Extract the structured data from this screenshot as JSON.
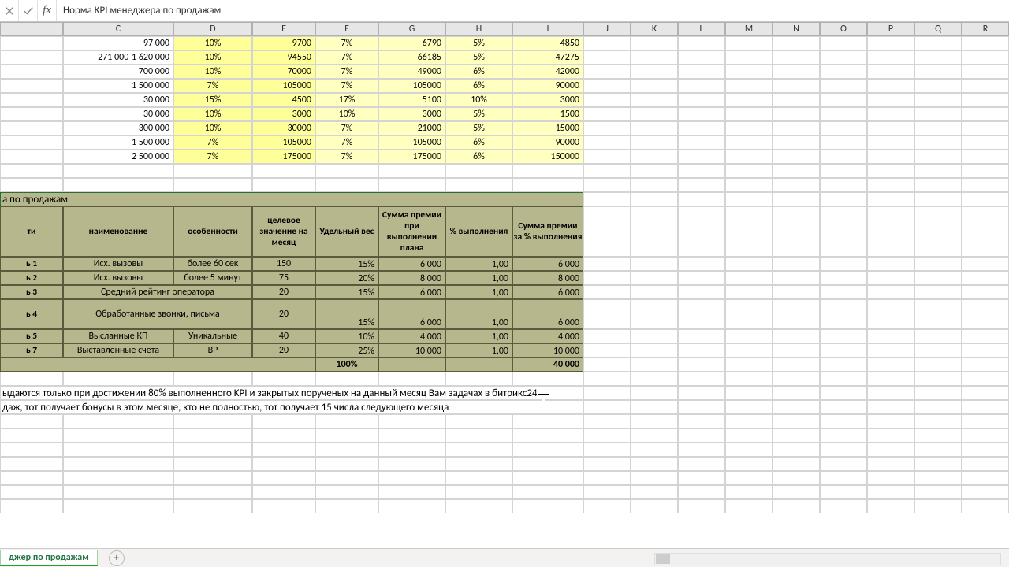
{
  "formula": "Норма KPI менеджера по продажам",
  "columns": [
    "",
    "C",
    "D",
    "E",
    "F",
    "G",
    "H",
    "I",
    "J",
    "K",
    "L",
    "M",
    "N",
    "O",
    "P",
    "Q",
    "R"
  ],
  "upperRows": [
    {
      "c": "97 000",
      "d": "10%",
      "e": "9700",
      "f": "7%",
      "g": "6790",
      "h": "5%",
      "i": "4850"
    },
    {
      "c": "271 000-1 620 000",
      "d": "10%",
      "e": "94550",
      "f": "7%",
      "g": "66185",
      "h": "5%",
      "i": "47275"
    },
    {
      "c": "700 000",
      "d": "10%",
      "e": "70000",
      "f": "7%",
      "g": "49000",
      "h": "6%",
      "i": "42000"
    },
    {
      "c": "1 500 000",
      "d": "7%",
      "e": "105000",
      "f": "7%",
      "g": "105000",
      "h": "6%",
      "i": "90000"
    },
    {
      "c": "30 000",
      "d": "15%",
      "e": "4500",
      "f": "17%",
      "g": "5100",
      "h": "10%",
      "i": "3000"
    },
    {
      "c": "30 000",
      "d": "10%",
      "e": "3000",
      "f": "10%",
      "g": "3000",
      "h": "5%",
      "i": "1500"
    },
    {
      "c": "300 000",
      "d": "10%",
      "e": "30000",
      "f": "7%",
      "g": "21000",
      "h": "5%",
      "i": "15000"
    },
    {
      "c": "1 500 000",
      "d": "7%",
      "e": "105000",
      "f": "7%",
      "g": "105000",
      "h": "6%",
      "i": "90000"
    },
    {
      "c": "2 500 000",
      "d": "7%",
      "e": "175000",
      "f": "7%",
      "g": "175000",
      "h": "6%",
      "i": "150000"
    }
  ],
  "tableTitle": "а по продажам",
  "tableHeaders": {
    "a": "ти",
    "c": "наименование",
    "d": "особенности",
    "e": "целевое значение на месяц",
    "f": "Удельный вес",
    "g": "Сумма премии при выполнении плана",
    "h": "% выполнения",
    "i": "Сумма премии за % выполнения"
  },
  "kpiRows": [
    {
      "n": "ь 1",
      "name": "Исх. вызовы",
      "feat": "более 60 сек",
      "target": "150",
      "weight": "15%",
      "bonus": "6 000",
      "done": "1,00",
      "pay": "6 000"
    },
    {
      "n": "ь 2",
      "name": "Исх. вызовы",
      "feat": "более 5 минут",
      "target": "75",
      "weight": "20%",
      "bonus": "8 000",
      "done": "1,00",
      "pay": "8 000"
    },
    {
      "n": "ь 3",
      "name": "Средний рейтинг оператора",
      "feat": "",
      "target": "20",
      "weight": "15%",
      "bonus": "6 000",
      "done": "1,00",
      "pay": "6 000",
      "span": true
    },
    {
      "n": "ь 4",
      "name": "Обработанные звонки, письма",
      "feat": "",
      "target": "20",
      "weight": "15%",
      "bonus": "6 000",
      "done": "1,00",
      "pay": "6 000",
      "span": true,
      "tall": true
    },
    {
      "n": "ь 5",
      "name": "Высланные КП",
      "feat": "Уникальные",
      "target": "40",
      "weight": "10%",
      "bonus": "4 000",
      "done": "1,00",
      "pay": "4 000"
    },
    {
      "n": "ь 7",
      "name": "Выставленные счета",
      "feat": "ВР",
      "target": "20",
      "weight": "25%",
      "bonus": "10 000",
      "done": "1,00",
      "pay": "10 000"
    }
  ],
  "totals": {
    "weight": "100%",
    "pay": "40 000"
  },
  "notes": [
    "ыдаются только при достижении 80% выполненного KPI и закрытых порученых на данный месяц Вам задачах в битрикс24",
    "даж, тот получает бонусы в этом месяце, кто не полностью, тот получает 15 числа следующего месяца"
  ],
  "sheetTab": "джер по продажам",
  "colWidths": {
    "A": 80,
    "C": 140,
    "D": 100,
    "E": 80,
    "F": 80,
    "G": 85,
    "H": 85,
    "I": 90,
    "rest": 60
  }
}
